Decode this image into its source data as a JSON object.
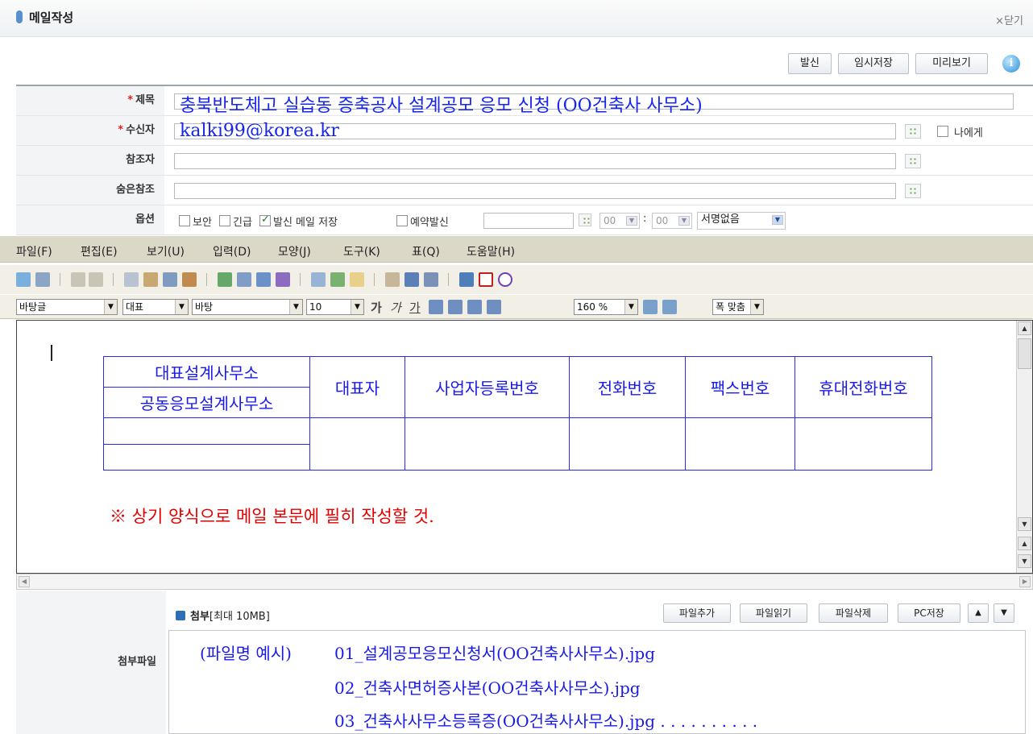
{
  "window": {
    "title": "메일작성",
    "close_label": "×닫기"
  },
  "actions": {
    "send": "발신",
    "save_draft": "임시저장",
    "preview": "미리보기",
    "help": "i"
  },
  "form": {
    "subject": {
      "label": "제목",
      "value": "충북반도체고 실습동 증축공사 설계공모 응모 신청 (OO건축사 사무소)"
    },
    "recipient": {
      "label": "수신자",
      "value": "kalki99@korea.kr",
      "to_me": "나에게"
    },
    "cc": {
      "label": "참조자",
      "value": ""
    },
    "bcc": {
      "label": "숨은참조",
      "value": ""
    },
    "options": {
      "label": "옵션",
      "security": "보안",
      "urgent": "긴급",
      "save_sent": "발신 메일 저장",
      "scheduled": "예약발신",
      "hour": "00",
      "minute": "00",
      "time_sep": ":",
      "signature": "서명없음",
      "checked": {
        "security": false,
        "urgent": false,
        "save_sent": true,
        "scheduled": false
      }
    }
  },
  "menu": [
    "파일(F)",
    "편집(E)",
    "보기(U)",
    "입력(D)",
    "모양(J)",
    "도구(K)",
    "표(Q)",
    "도움말(H)"
  ],
  "format": {
    "style": "바탕글",
    "lang": "대표",
    "font": "바탕",
    "size": "10",
    "bold": "가",
    "italic": "가",
    "underline": "가",
    "line_spacing": "160 %",
    "fit": "폭 맞춤"
  },
  "editor": {
    "table": {
      "h1a": "대표설계사무소",
      "h1b": "공동응모설계사무소",
      "h2": "대표자",
      "h3": "사업자등록번호",
      "h4": "전화번호",
      "h5": "팩스번호",
      "h6": "휴대전화번호"
    },
    "notice": "※ 상기 양식으로 메일 본문에 필히 작성할 것."
  },
  "attachments": {
    "label": "첨부파일",
    "title": "첨부",
    "limit": "[최대 10MB]",
    "buttons": {
      "add": "파일추가",
      "read": "파일읽기",
      "delete": "파일삭제",
      "pc_save": "PC저장"
    },
    "example_label": "(파일명 예시)",
    "files": [
      "01_설계공모응모신청서(OO건축사사무소).jpg",
      "02_건축사면허증사본(OO건축사사무소).jpg",
      "03_건축사사무소등록증(OO건축사사무소).jpg . . . . . . . . . ."
    ]
  }
}
